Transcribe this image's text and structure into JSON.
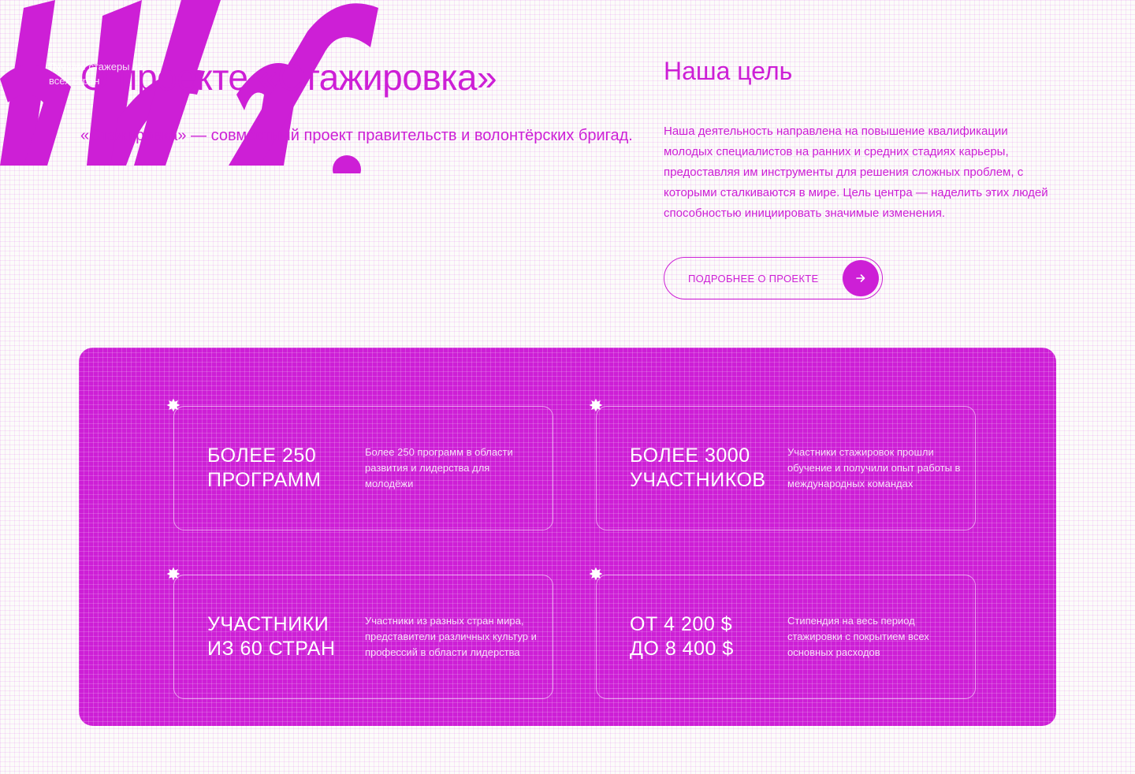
{
  "about": {
    "title": "О проекте «Стажировка»",
    "text": "«Стажировка» — совместный проект правительств и волонтёрских бригад.",
    "tag_note": "Лучшие стажеры из всех стран"
  },
  "goal": {
    "title": "Наша цель",
    "text": "Наша деятельность направлена на повышение квалификации молодых специалистов на ранних и средних стадиях карьеры, предоставляя им инструменты для решения сложных проблем, с которыми сталкиваются в мире. Цель центра — наделить этих людей способностью инициировать значимые изменения.",
    "button_label": "ПОДРОБНЕЕ О ПРОЕКТЕ",
    "button_icon": "arrow-right-icon"
  },
  "stats": [
    {
      "line1": "БОЛЕЕ 250",
      "line2": "ПРОГРАММ",
      "desc": "Более 250 программ в области развития и лидерства для молодёжи"
    },
    {
      "line1": "БОЛЕЕ 3000",
      "line2": "УЧАСТНИКОВ",
      "desc": "Участники стажировок прошли обучение и получили опыт работы в международных командах"
    },
    {
      "line1": "УЧАСТНИКИ",
      "line2": "ИЗ 60 СТРАН",
      "desc": "Участники из разных стран мира, представители различных культур и профессий в области лидерства"
    },
    {
      "line1": "ОТ 4 200 $",
      "line2": "ДО 8 400 $",
      "desc": "Стипендия на весь период стажировки с покрытием всех основных расходов"
    }
  ],
  "colors": {
    "accent": "#cd1fd6",
    "background": "#fcfcfa",
    "on_accent": "#ffffff"
  }
}
